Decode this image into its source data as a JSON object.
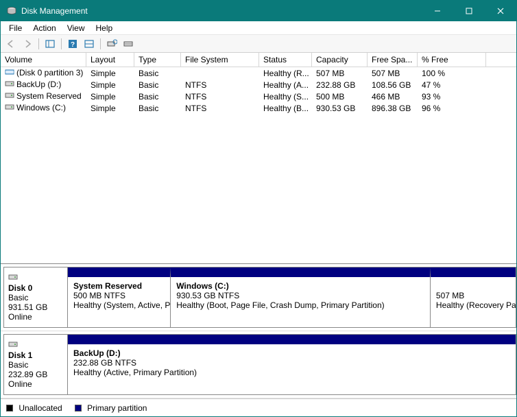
{
  "window": {
    "title": "Disk Management"
  },
  "menu": {
    "file": "File",
    "action": "Action",
    "view": "View",
    "help": "Help"
  },
  "headers": {
    "volume": "Volume",
    "layout": "Layout",
    "type": "Type",
    "fs": "File System",
    "status": "Status",
    "capacity": "Capacity",
    "free": "Free Spa...",
    "pct": "% Free"
  },
  "volumes": [
    {
      "name": "(Disk 0 partition 3)",
      "layout": "Simple",
      "type": "Basic",
      "fs": "",
      "status": "Healthy (R...",
      "capacity": "507 MB",
      "free": "507 MB",
      "pct": "100 %"
    },
    {
      "name": "BackUp (D:)",
      "layout": "Simple",
      "type": "Basic",
      "fs": "NTFS",
      "status": "Healthy (A...",
      "capacity": "232.88 GB",
      "free": "108.56 GB",
      "pct": "47 %"
    },
    {
      "name": "System Reserved",
      "layout": "Simple",
      "type": "Basic",
      "fs": "NTFS",
      "status": "Healthy (S...",
      "capacity": "500 MB",
      "free": "466 MB",
      "pct": "93 %"
    },
    {
      "name": "Windows (C:)",
      "layout": "Simple",
      "type": "Basic",
      "fs": "NTFS",
      "status": "Healthy (B...",
      "capacity": "930.53 GB",
      "free": "896.38 GB",
      "pct": "96 %"
    }
  ],
  "disks": [
    {
      "name": "Disk 0",
      "type": "Basic",
      "size": "931.51 GB",
      "state": "Online",
      "parts": [
        {
          "title": "System Reserved",
          "line2": "500 MB NTFS",
          "line3": "Healthy (System, Active, Primary Partition)",
          "hatched": false,
          "width": "23%"
        },
        {
          "title": "Windows  (C:)",
          "line2": "930.53 GB NTFS",
          "line3": "Healthy (Boot, Page File, Crash Dump, Primary Partition)",
          "hatched": false,
          "width": "58%"
        },
        {
          "title": "",
          "line2": "507 MB",
          "line3": "Healthy (Recovery Partition)",
          "hatched": true,
          "width": "19%"
        }
      ]
    },
    {
      "name": "Disk 1",
      "type": "Basic",
      "size": "232.89 GB",
      "state": "Online",
      "parts": [
        {
          "title": "BackUp  (D:)",
          "line2": "232.88 GB NTFS",
          "line3": "Healthy (Active, Primary Partition)",
          "hatched": false,
          "width": "100%"
        }
      ]
    }
  ],
  "legend": {
    "unalloc": "Unallocated",
    "primary": "Primary partition"
  },
  "colors": {
    "primary_partition": "#000080",
    "unallocated": "#000000",
    "titlebar": "#0a7a7a"
  }
}
